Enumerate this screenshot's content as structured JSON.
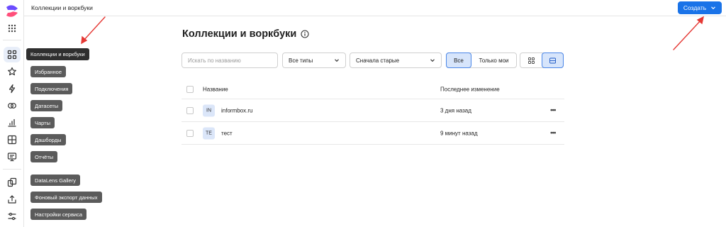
{
  "header": {
    "title": "Коллекции и воркбуки",
    "create_label": "Создать"
  },
  "sidebar_tags": {
    "collections": "Коллекции и воркбуки",
    "favorites": "Избранное",
    "connections": "Подключения",
    "datasets": "Датасеты",
    "charts": "Чарты",
    "dashboards": "Дашборды",
    "reports": "Отчёты",
    "gallery": "DataLens Gallery",
    "export": "Фоновый экспорт данных",
    "settings": "Настройки сервиса"
  },
  "main": {
    "title": "Коллекции и воркбуки",
    "search_placeholder": "Искать по названию",
    "types_value": "Все типы",
    "sort_value": "Сначала старые",
    "filter_all": "Все",
    "filter_mine": "Только мои"
  },
  "table": {
    "col_name": "Название",
    "col_modified": "Последнее изменение",
    "rows": [
      {
        "badge": "IN",
        "name": "informbox.ru",
        "modified": "3 дня назад"
      },
      {
        "badge": "TE",
        "name": "тест",
        "modified": "9 минут назад"
      }
    ]
  },
  "colors": {
    "accent": "#1a73e8",
    "selected_bg": "#d7e5fb",
    "annotation": "#e53935"
  }
}
